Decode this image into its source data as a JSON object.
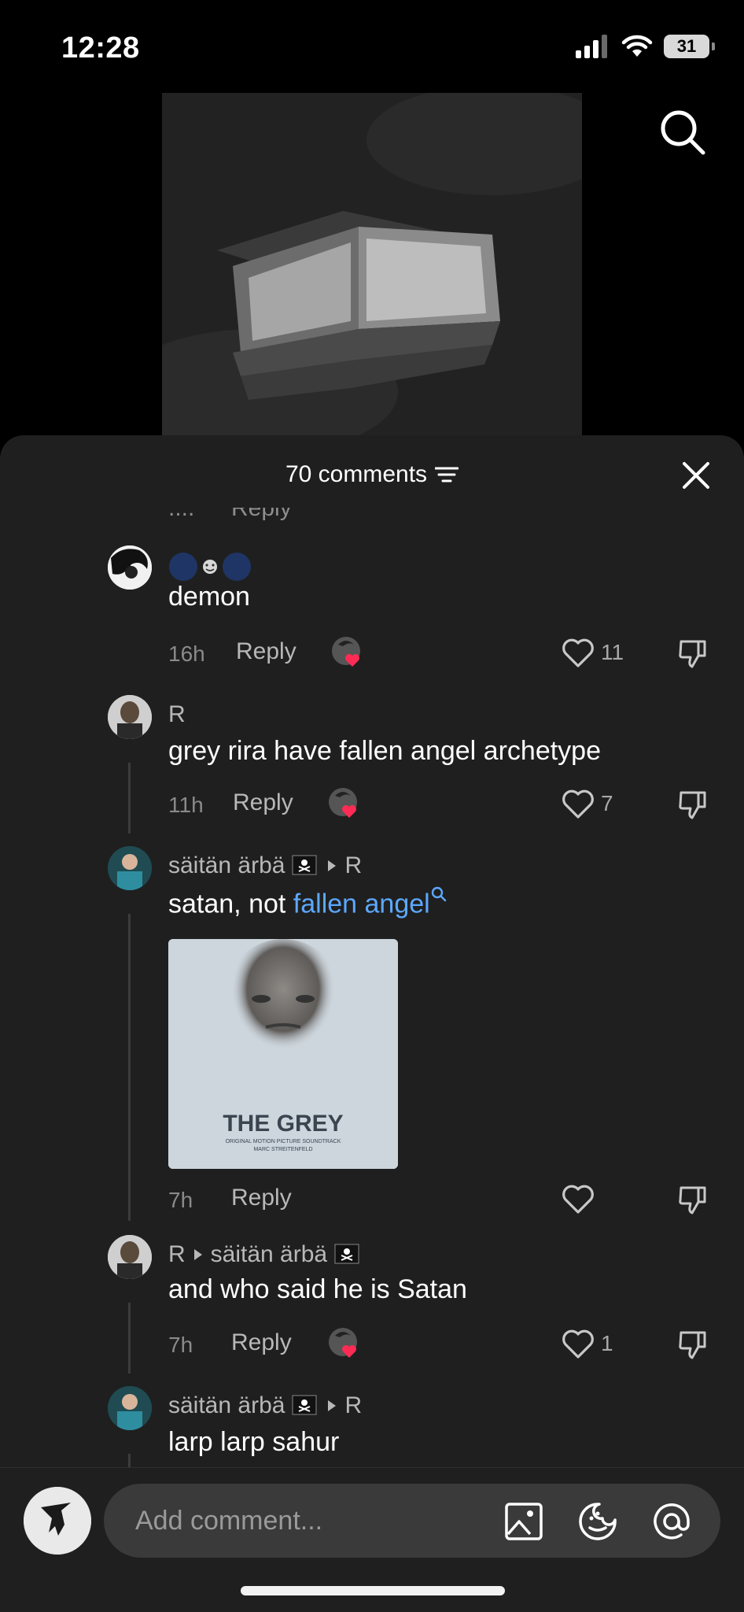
{
  "status_bar": {
    "time": "12:28",
    "battery": "31"
  },
  "comments_header": {
    "title": "70 comments"
  },
  "faded_row": {
    "time": "....",
    "reply": "Reply"
  },
  "comments": [
    {
      "username": "",
      "text": "demon",
      "time": "16h",
      "reply": "Reply",
      "likes": "11",
      "liked_by_creator": true
    },
    {
      "username": "R",
      "text": "grey rira have fallen angel archetype",
      "time": "11h",
      "reply": "Reply",
      "likes": "7",
      "liked_by_creator": true
    },
    {
      "username": "säitän ärbä",
      "reply_to": "R",
      "text_prefix": "satan, not ",
      "link_text": "fallen angel",
      "image_caption": {
        "title": "THE GREY",
        "sub1": "ORIGINAL MOTION PICTURE SOUNDTRACK",
        "sub2": "MARC STREITENFELD"
      },
      "time": "7h",
      "reply": "Reply",
      "likes": ""
    },
    {
      "username": "R",
      "reply_to": "säitän ärbä",
      "text": "and who said he is Satan",
      "time": "7h",
      "reply": "Reply",
      "likes": "1",
      "liked_by_creator": true
    },
    {
      "username": "säitän ärbä",
      "reply_to": "R",
      "text": "larp larp sahur"
    }
  ],
  "input": {
    "placeholder": "Add comment..."
  },
  "icons": {
    "search": "search-icon",
    "filter": "filter-icon",
    "close": "close-icon",
    "like": "heart-icon",
    "dislike": "thumbs-down-icon",
    "image": "image-icon",
    "sticker": "sticker-icon",
    "mention": "at-icon"
  },
  "colors": {
    "background": "#000000",
    "sheet": "#1f1f1f",
    "link": "#5ca8ff",
    "heart": "#fe2c55"
  }
}
